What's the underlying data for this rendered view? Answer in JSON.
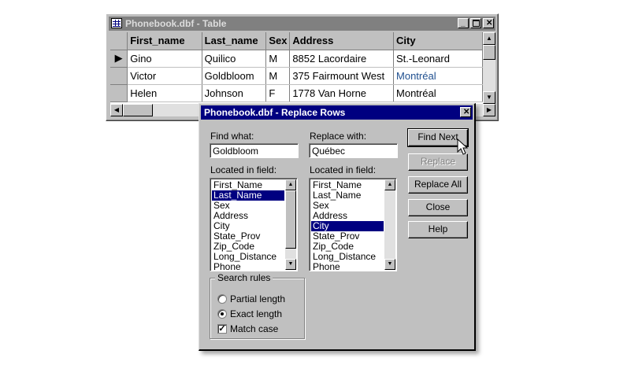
{
  "table_window": {
    "title": "Phonebook.dbf - Table",
    "columns": [
      "First_name",
      "Last_name",
      "Sex",
      "Address",
      "City"
    ],
    "rows": [
      {
        "first": "Gino",
        "last": "Quilico",
        "sex": "M",
        "address": "8852 Lacordaire",
        "city": "St.-Leonard",
        "current": true
      },
      {
        "first": "Victor",
        "last": "Goldbloom",
        "sex": "M",
        "address": "375 Fairmount West",
        "city": "Montréal"
      },
      {
        "first": "Helen",
        "last": "Johnson",
        "sex": "F",
        "address": "1778 Van Horne",
        "city": "Montréal"
      }
    ],
    "current_row_marker": "▶",
    "highlight_color": "#1f4f8f"
  },
  "dialog": {
    "title": "Phonebook.dbf - Replace Rows",
    "find_label": "Find what:",
    "find_value": "Goldbloom",
    "replace_label": "Replace with:",
    "replace_value": "Québec",
    "located_left_label": "Located in field:",
    "located_right_label": "Located in field:",
    "fields": [
      "First_Name",
      "Last_Name",
      "Sex",
      "Address",
      "City",
      "State_Prov",
      "Zip_Code",
      "Long_Distance",
      "Phone"
    ],
    "left_selected": "Last_Name",
    "right_selected": "City",
    "buttons": {
      "find_next": "Find Next",
      "replace": "Replace",
      "replace_all": "Replace All",
      "close": "Close",
      "help": "Help"
    },
    "search_rules": {
      "legend": "Search rules",
      "partial": "Partial length",
      "exact": "Exact length",
      "match_case": "Match case",
      "partial_selected": false,
      "exact_selected": true,
      "match_case_checked": true
    }
  }
}
